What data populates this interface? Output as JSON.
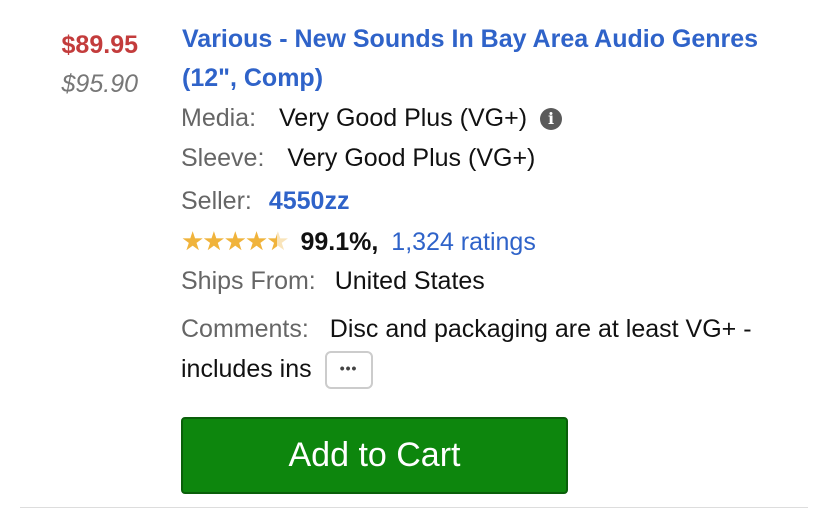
{
  "colors": {
    "price": "#c33c3c",
    "link": "#2f63c9",
    "star": "#f0b33b",
    "cart_button": "#0d860d"
  },
  "listing": {
    "price": "$89.95",
    "original_price": "$95.90",
    "title": "Various - New Sounds In Bay Area Audio Genres (12\", Comp)",
    "media_label": "Media:",
    "media_value": "Very Good Plus (VG+)",
    "media_info_icon": "info-icon",
    "sleeve_label": "Sleeve:",
    "sleeve_value": "Very Good Plus (VG+)",
    "seller_label": "Seller:",
    "seller_name": "4550zz",
    "seller_rating_stars": 4.5,
    "seller_rating_percent": "99.1%,",
    "seller_ratings_count": "1,324 ratings",
    "ships_from_label": "Ships From:",
    "ships_from_value": "United States",
    "comments_label": "Comments:",
    "comments_value": "Disc and packaging are at least VG+ - includes ins",
    "more_button_label": "•••",
    "add_to_cart_label": "Add to Cart"
  }
}
